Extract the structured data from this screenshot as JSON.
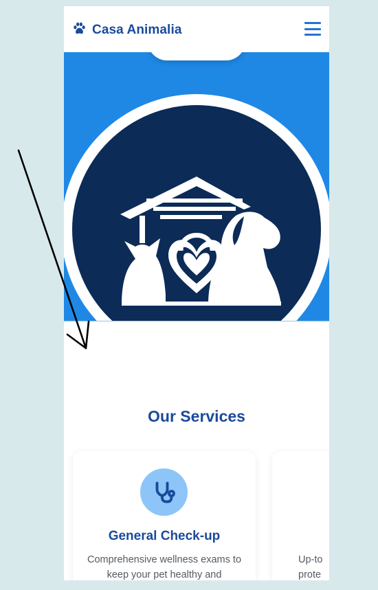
{
  "header": {
    "brand_icon": "paw-icon",
    "brand_title": "Casa Animalia",
    "menu_icon": "hamburger-menu-icon"
  },
  "hero": {
    "logo": "house-cat-dog-heart-logo"
  },
  "services": {
    "title": "Our Services",
    "cards": [
      {
        "icon": "stethoscope-icon",
        "title": "General Check-up",
        "description": "Comprehensive wellness exams to keep your pet healthy and"
      },
      {
        "description_line1": "Up-to",
        "description_line2": "prote"
      }
    ]
  },
  "colors": {
    "primary_blue": "#1f88e5",
    "navy": "#0c2b57",
    "heading_blue": "#1a4a9c",
    "icon_circle": "#8ec5f8",
    "background": "#d8e9ec"
  }
}
